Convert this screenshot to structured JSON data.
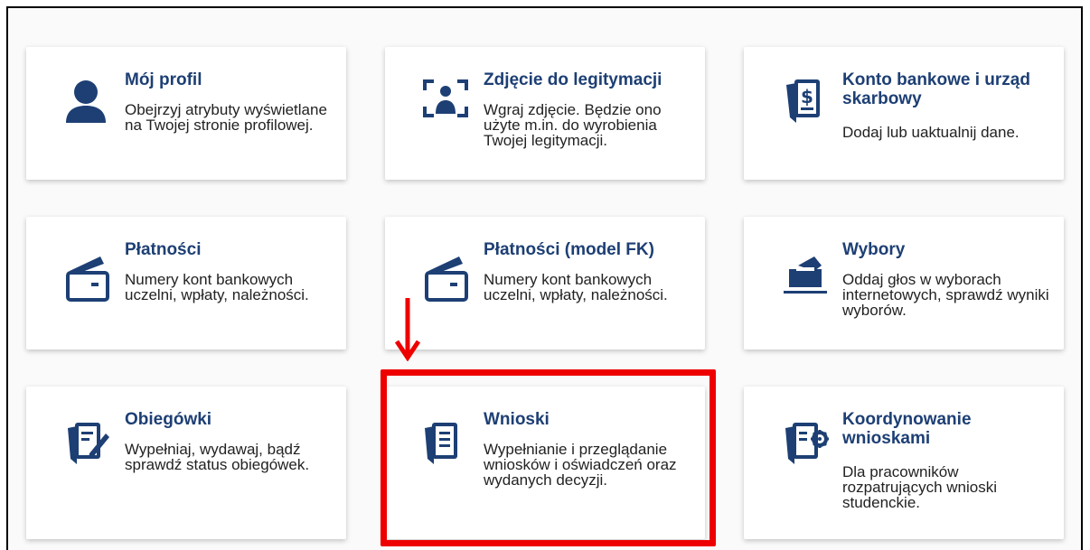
{
  "tiles": [
    {
      "icon": "user-icon",
      "title": "Mój profil",
      "desc": "Obejrzyj atrybuty wyświetlane na Twojej stronie profilowej."
    },
    {
      "icon": "id-photo-icon",
      "title": "Zdjęcie do legitymacji",
      "desc": "Wgraj zdjęcie. Będzie ono użyte m.in. do wyrobienia Twojej legitymacji."
    },
    {
      "icon": "bank-document-icon",
      "title": "Konto bankowe i urząd skarbowy",
      "desc": "Dodaj lub uaktualnij dane."
    },
    {
      "icon": "wallet-icon",
      "title": "Płatności",
      "desc": "Numery kont bankowych uczelni, wpłaty, należności."
    },
    {
      "icon": "wallet-icon",
      "title": "Płatności (model FK)",
      "desc": "Numery kont bankowych uczelni, wpłaty, należności."
    },
    {
      "icon": "ballot-box-icon",
      "title": "Wybory",
      "desc": "Oddaj głos w wyborach internetowych, sprawdź wyniki wyborów."
    },
    {
      "icon": "document-edit-icon",
      "title": "Obiegówki",
      "desc": "Wypełniaj, wydawaj, bądź sprawdź status obiegówek."
    },
    {
      "icon": "document-list-icon",
      "title": "Wnioski",
      "desc": "Wypełnianie i przeglądanie wniosków i oświadczeń oraz wydanych decyzji."
    },
    {
      "icon": "document-gear-icon",
      "title": "Koordynowanie wnioskami",
      "desc": "Dla pracowników rozpatrujących wnioski studenckie."
    }
  ],
  "colors": {
    "brand": "#1d3f74",
    "highlight": "#ee0000",
    "text": "#222222"
  }
}
